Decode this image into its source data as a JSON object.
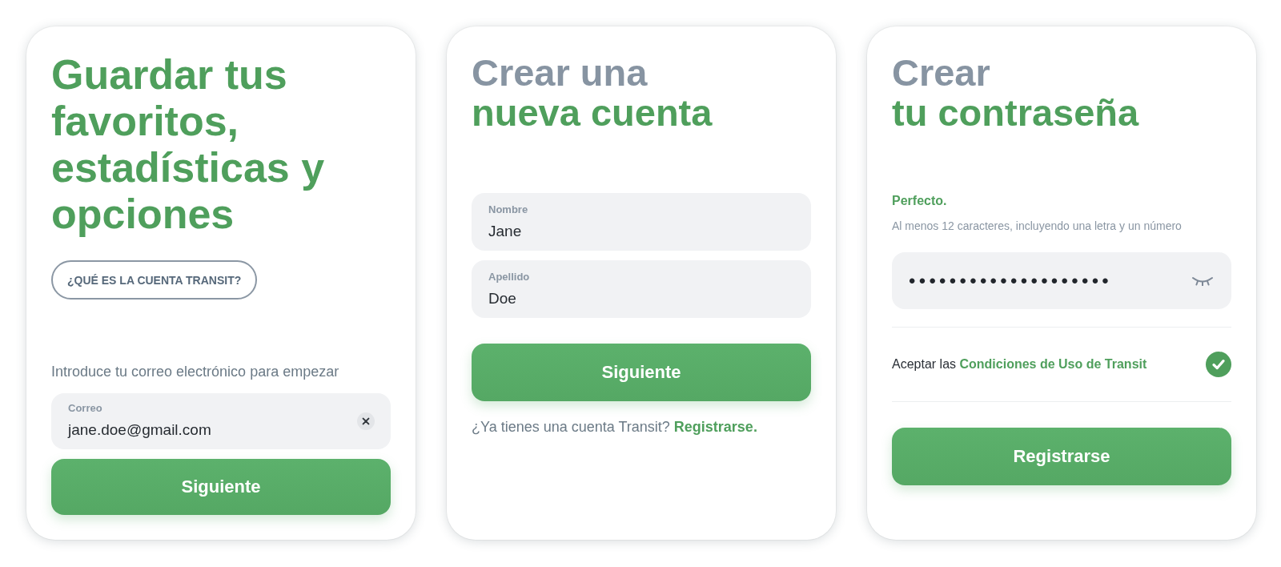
{
  "email_screen": {
    "title": [
      {
        "text": "Guardar tus favoritos, estadísticas y opciones",
        "kind": "accent"
      }
    ],
    "info_button": "¿QUÉ ES LA CUENTA TRANSIT?",
    "prompt": "Introduce tu correo electrónico para empezar",
    "email_field": {
      "label": "Correo",
      "value": "jane.doe@gmail.com"
    },
    "next_button": "Siguiente"
  },
  "name_screen": {
    "title": [
      {
        "text": "Crear una",
        "kind": "muted"
      },
      {
        "text": "nueva cuenta",
        "kind": "accent"
      }
    ],
    "fields": [
      {
        "label": "Nombre",
        "value": "Jane"
      },
      {
        "label": "Apellido",
        "value": "Doe"
      }
    ],
    "next_button": "Siguiente",
    "signin_prompt": {
      "text": "¿Ya tienes una cuenta Transit?",
      "link": "Registrarse."
    }
  },
  "password_screen": {
    "title": [
      {
        "text": "Crear",
        "kind": "muted"
      },
      {
        "text": "tu contraseña",
        "kind": "accent"
      }
    ],
    "strength": "Perfecto.",
    "hint": "Al menos 12 caracteres, incluyendo una letra y un número",
    "password_field": {
      "value": "••••••••••••••••••••",
      "masked": true
    },
    "terms": {
      "text": "Aceptar las",
      "link": "Condiciones de Uso de Transit",
      "checked": true
    },
    "submit_button": "Registrarse"
  }
}
